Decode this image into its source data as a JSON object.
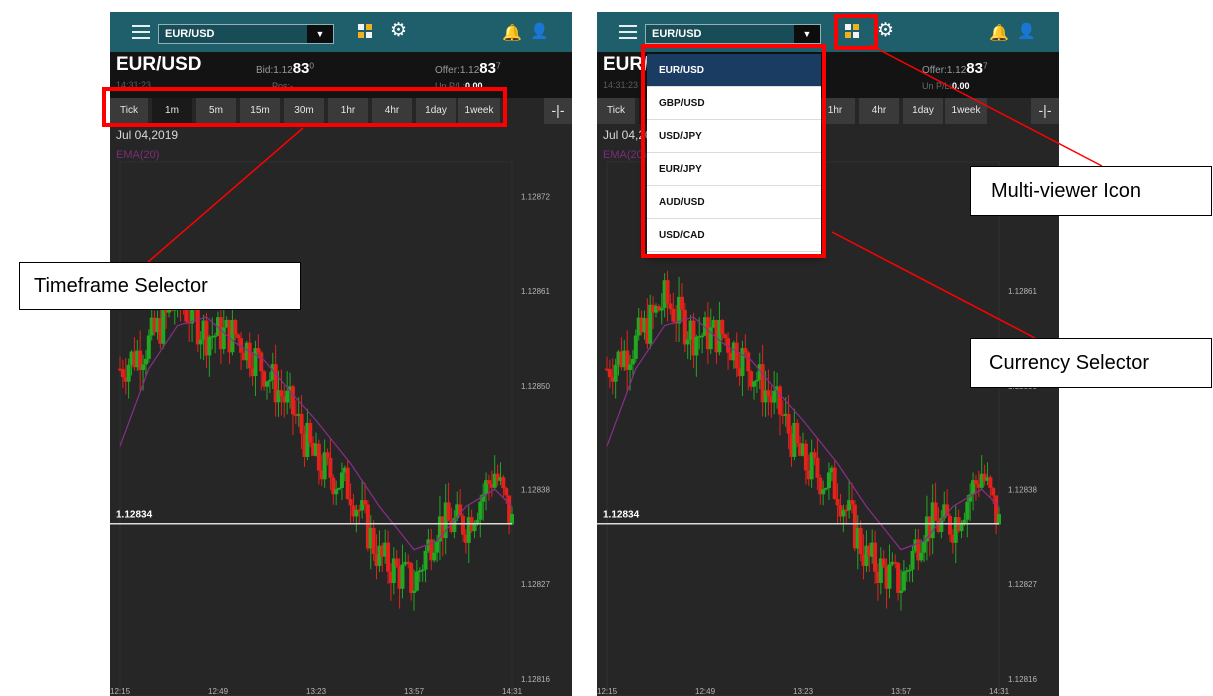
{
  "colors": {
    "topbar": "#1f5f6b",
    "chart_bg": "#262626",
    "candle_up": "#22a722",
    "candle_down": "#e3221c",
    "ema_line": "#8a2e8a",
    "highlight": "#ff0000",
    "dropdown_selected": "#1a3c63"
  },
  "app": {
    "pair_selector": "EUR/USD",
    "icons": [
      "menu-icon",
      "chevron-down-icon",
      "multi-viewer-icon",
      "gear-icon",
      "bell-icon",
      "user-icon"
    ]
  },
  "quote": {
    "symbol": "EUR/USD",
    "time": "14:31:23",
    "bid_label": "Bid:",
    "bid_prefix": "1.12",
    "bid_big": "83",
    "bid_sup": "0",
    "offer_label": "Offer:",
    "offer_prefix": "1.12",
    "offer_big": "83",
    "offer_sup": "7",
    "pos_label": "Pos:",
    "pos_value": "-",
    "upl_label": "Un P/L:",
    "upl_value": "0.00"
  },
  "timeframes": [
    "Tick",
    "1m",
    "5m",
    "15m",
    "30m",
    "1hr",
    "4hr",
    "1day",
    "1week"
  ],
  "active_timeframe": "1m",
  "crosshair_icon": "crosshair-icon",
  "chart": {
    "date": "Jul 04,2019",
    "indicator": "EMA(20)",
    "current_price": "1.12834",
    "y_ticks": [
      "1.12872",
      "1.12861",
      "1.12850",
      "1.12838",
      "1.12827",
      "1.12816"
    ],
    "x_ticks": [
      "12:15",
      "12:49",
      "13:23",
      "13:57",
      "14:31"
    ]
  },
  "chart_data": {
    "type": "line",
    "title": "",
    "xlabel": "",
    "ylabel": "",
    "ylim": [
      1.12814,
      1.12876
    ],
    "x_ticks": [
      "12:15",
      "12:49",
      "13:23",
      "13:57",
      "14:31"
    ],
    "y_ticks": [
      1.12872,
      1.12861,
      1.1285,
      1.12838,
      1.12827,
      1.12816
    ],
    "series": [
      {
        "name": "EMA(20)",
        "x": [
          "12:15",
          "12:25",
          "12:35",
          "12:45",
          "12:55",
          "13:05",
          "13:15",
          "13:23",
          "13:35",
          "13:45",
          "13:57",
          "14:05",
          "14:15",
          "14:25",
          "14:31"
        ],
        "y": [
          1.12843,
          1.12852,
          1.12857,
          1.12858,
          1.12855,
          1.12853,
          1.12849,
          1.12846,
          1.12841,
          1.12836,
          1.12831,
          1.12832,
          1.12836,
          1.12838,
          1.12836
        ]
      }
    ],
    "price_path": {
      "x": [
        "12:15",
        "12:25",
        "12:35",
        "12:45",
        "12:55",
        "13:05",
        "13:15",
        "13:23",
        "13:35",
        "13:45",
        "13:57",
        "14:05",
        "14:15",
        "14:25",
        "14:31"
      ],
      "y": [
        1.12852,
        1.12855,
        1.1286,
        1.12856,
        1.12856,
        1.12852,
        1.12847,
        1.12841,
        1.12838,
        1.1283,
        1.12827,
        1.12834,
        1.12834,
        1.1284,
        1.12834
      ]
    },
    "horizontal_line": 1.12834,
    "grid": false
  },
  "dropdown_items": [
    "EUR/USD",
    "GBP/USD",
    "USD/JPY",
    "EUR/JPY",
    "AUD/USD",
    "USD/CAD"
  ],
  "dropdown_selected": "EUR/USD",
  "callouts": {
    "timeframe": "Timeframe Selector",
    "multiviewer": "Multi-viewer Icon",
    "currency": "Currency Selector"
  }
}
